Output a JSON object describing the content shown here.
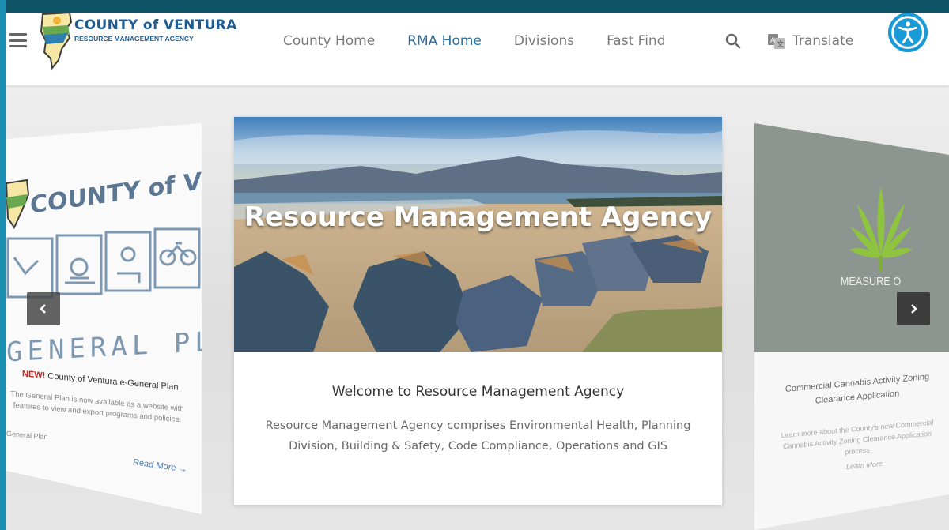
{
  "header": {
    "logo_title": "COUNTY of VENTURA",
    "logo_subtitle": "RESOURCE MANAGEMENT AGENCY",
    "nav": [
      {
        "label": "County Home",
        "active": false
      },
      {
        "label": "RMA Home",
        "active": true
      },
      {
        "label": "Divisions",
        "active": false
      },
      {
        "label": "Fast Find",
        "active": false
      }
    ],
    "translate_label": "Translate"
  },
  "carousel": {
    "left_slide": {
      "logo_text": "COUNTY of VENTURA",
      "banner": "GENERAL PLAN",
      "new_label": "NEW!",
      "headline": "County of Ventura e-General Plan",
      "description": "The General Plan is now available as a website with features to view and export programs and policies.",
      "tag": "General Plan",
      "read_more": "Read More →"
    },
    "center_slide": {
      "hero_title": "Resource Management Agency",
      "title": "Welcome to Resource Management Agency",
      "description": "Resource Management Agency comprises Environmental Health, Planning Division, Building & Safety, Code Compliance, Operations and GIS"
    },
    "right_slide": {
      "image_label": "MEASURE O",
      "title": "Commercial Cannabis Activity Zoning Clearance Application",
      "description": "Learn more about the County's new Commercial Cannabis Activity Zoning Clearance Application process",
      "learn_more": "Learn More"
    }
  },
  "colors": {
    "accent": "#2a6ea0",
    "frame_bg": "#0e5466",
    "access_button": "#1a9ad6"
  }
}
